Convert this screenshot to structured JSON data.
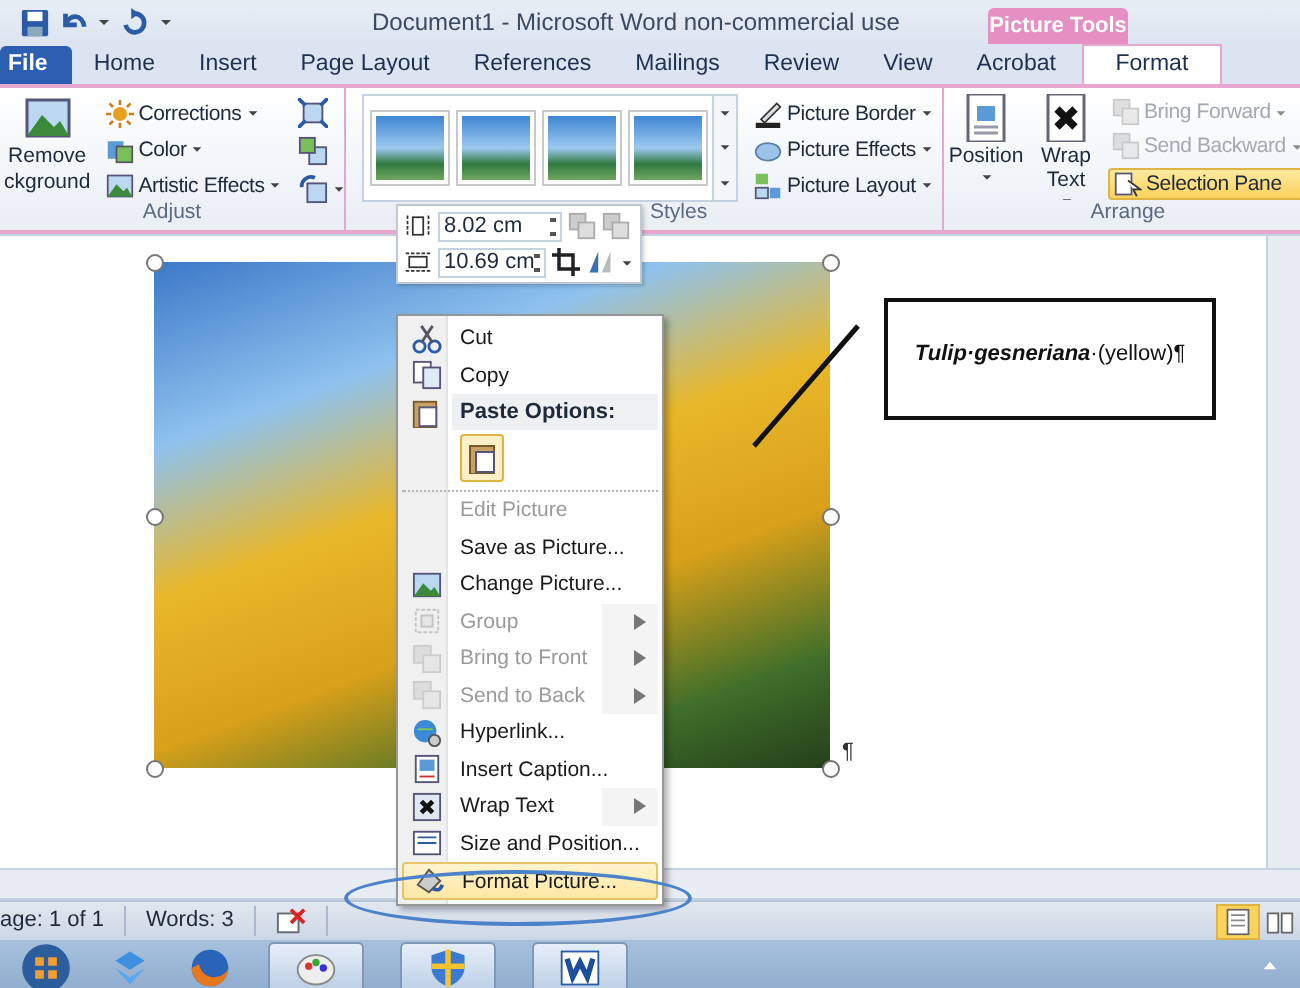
{
  "window": {
    "title": "Document1  -  Microsoft Word non-commercial use",
    "context_label": "Picture Tools"
  },
  "tabs": [
    {
      "label": "File",
      "kind": "file",
      "selected": false
    },
    {
      "label": "Home",
      "kind": "normal",
      "selected": false
    },
    {
      "label": "Insert",
      "kind": "normal",
      "selected": false
    },
    {
      "label": "Page Layout",
      "kind": "normal",
      "selected": false
    },
    {
      "label": "References",
      "kind": "normal",
      "selected": false
    },
    {
      "label": "Mailings",
      "kind": "normal",
      "selected": false
    },
    {
      "label": "Review",
      "kind": "normal",
      "selected": false
    },
    {
      "label": "View",
      "kind": "normal",
      "selected": false
    },
    {
      "label": "Acrobat",
      "kind": "normal",
      "selected": false
    },
    {
      "label": "Format",
      "kind": "context",
      "selected": true
    }
  ],
  "ribbon": {
    "adjust": {
      "label": "Adjust",
      "remove_background": "Remove ckground",
      "commands": [
        "Corrections",
        "Color",
        "Artistic Effects"
      ]
    },
    "styles": {
      "label": "Styles",
      "commands": [
        "Picture Border",
        "Picture Effects",
        "Picture Layout"
      ]
    },
    "arrange": {
      "label": "Arrange",
      "large": [
        "Position",
        "Wrap Text"
      ],
      "commands": [
        {
          "label": "Bring Forward",
          "disabled": true,
          "active": false
        },
        {
          "label": "Send Backward",
          "disabled": true,
          "active": false
        },
        {
          "label": "Selection Pane",
          "disabled": false,
          "active": true
        }
      ]
    }
  },
  "mini_toolbar": {
    "height": "8.02 cm",
    "width": "10.69 cm"
  },
  "document": {
    "paragraph_mark": "¶",
    "callout": "**Tulip·gesneriana**·(yellow)¶"
  },
  "context_menu": [
    {
      "kind": "item",
      "label": "Cut",
      "disabled": false,
      "submenu": false,
      "selected": false,
      "separator_before": false
    },
    {
      "kind": "item",
      "label": "Copy",
      "disabled": false,
      "submenu": false,
      "selected": false,
      "separator_before": false
    },
    {
      "kind": "header",
      "label": "Paste Options:"
    },
    {
      "kind": "paste"
    },
    {
      "kind": "item",
      "label": "Edit Picture",
      "disabled": true,
      "submenu": false,
      "selected": false,
      "separator_before": true
    },
    {
      "kind": "item",
      "label": "Save as Picture...",
      "disabled": false,
      "submenu": false,
      "selected": false,
      "separator_before": false
    },
    {
      "kind": "item",
      "label": "Change Picture...",
      "disabled": false,
      "submenu": false,
      "selected": false,
      "separator_before": false
    },
    {
      "kind": "item",
      "label": "Group",
      "disabled": true,
      "submenu": true,
      "selected": false,
      "separator_before": false
    },
    {
      "kind": "item",
      "label": "Bring to Front",
      "disabled": true,
      "submenu": true,
      "selected": false,
      "separator_before": false
    },
    {
      "kind": "item",
      "label": "Send to Back",
      "disabled": true,
      "submenu": true,
      "selected": false,
      "separator_before": false
    },
    {
      "kind": "item",
      "label": "Hyperlink...",
      "disabled": false,
      "submenu": false,
      "selected": false,
      "separator_before": false
    },
    {
      "kind": "item",
      "label": "Insert Caption...",
      "disabled": false,
      "submenu": false,
      "selected": false,
      "separator_before": false
    },
    {
      "kind": "item",
      "label": "Wrap Text",
      "disabled": false,
      "submenu": true,
      "selected": false,
      "separator_before": false
    },
    {
      "kind": "item",
      "label": "Size and Position...",
      "disabled": false,
      "submenu": false,
      "selected": false,
      "separator_before": false
    },
    {
      "kind": "item",
      "label": "Format Picture...",
      "disabled": false,
      "submenu": false,
      "selected": true,
      "separator_before": false
    }
  ],
  "status_bar": [
    "age: 1 of 1",
    "Words: 3"
  ]
}
